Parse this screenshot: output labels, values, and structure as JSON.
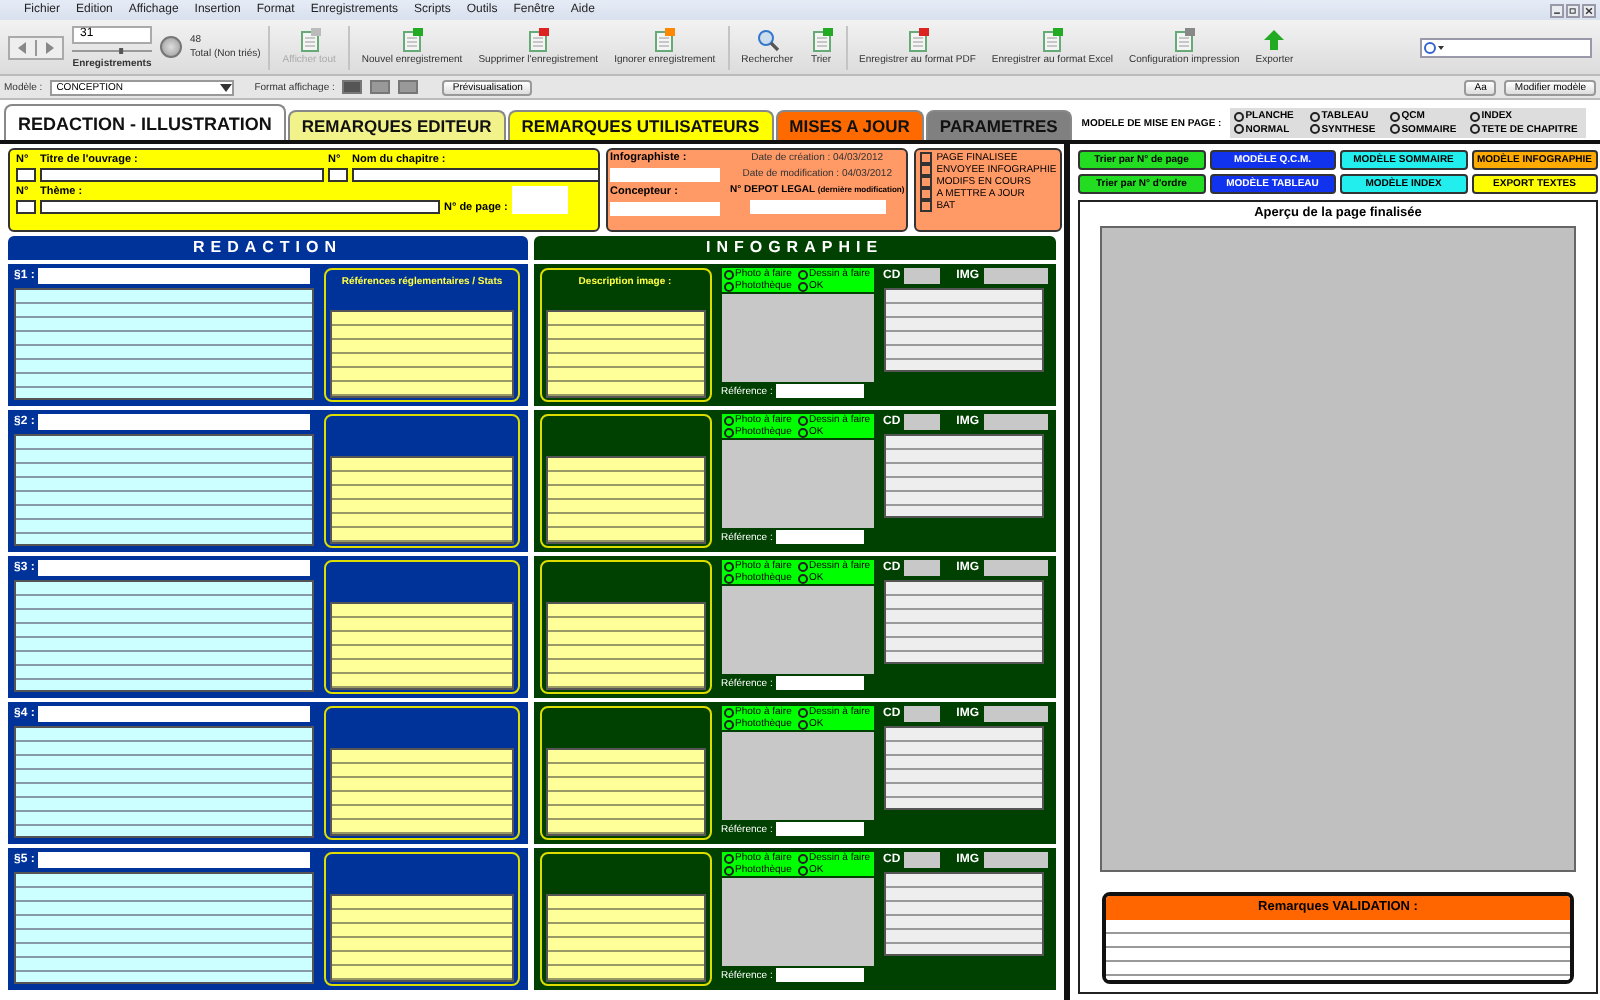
{
  "menu": [
    "Fichier",
    "Edition",
    "Affichage",
    "Insertion",
    "Format",
    "Enregistrements",
    "Scripts",
    "Outils",
    "Fenêtre",
    "Aide"
  ],
  "records": {
    "current": "31",
    "total": "48",
    "total_label": "Total (Non triés)",
    "label": "Enregistrements",
    "level": 0.62
  },
  "toolbar": [
    {
      "label": "Afficher tout",
      "kind": "show",
      "disabled": true
    },
    {
      "label": "Nouvel enregistrement",
      "kind": "new",
      "disabled": false
    },
    {
      "label": "Supprimer l'enregistrement",
      "kind": "delete",
      "disabled": false
    },
    {
      "label": "Ignorer enregistrement",
      "kind": "ignore",
      "disabled": false
    },
    {
      "label": "Rechercher",
      "kind": "search",
      "disabled": false
    },
    {
      "label": "Trier",
      "kind": "sort",
      "disabled": false
    },
    {
      "label": "Enregistrer au format PDF",
      "kind": "pdf",
      "disabled": false
    },
    {
      "label": "Enregistrer au format Excel",
      "kind": "excel",
      "disabled": false
    },
    {
      "label": "Configuration impression",
      "kind": "print",
      "disabled": false
    },
    {
      "label": "Exporter",
      "kind": "export",
      "disabled": false
    }
  ],
  "layout_bar": {
    "model_label": "Modèle :",
    "model": "CONCEPTION",
    "format_label": "Format affichage :",
    "preview": "Prévisualisation",
    "aa": "Aa",
    "edit_model": "Modifier modèle"
  },
  "tabs": [
    {
      "label": "REDACTION - ILLUSTRATION",
      "color": "#ffffff",
      "selected": true
    },
    {
      "label": "REMARQUES EDITEUR",
      "color": "#f2f28a",
      "selected": false
    },
    {
      "label": "REMARQUES UTILISATEURS",
      "color": "#ffff00",
      "selected": false
    },
    {
      "label": "MISES A JOUR",
      "color": "#ff6a00",
      "selected": false
    },
    {
      "label": "PARAMETRES",
      "color": "#808080",
      "selected": false
    }
  ],
  "page_model": {
    "label": "MODELE DE MISE EN PAGE :",
    "options": [
      {
        "label": "PLANCHE",
        "selected": false
      },
      {
        "label": "NORMAL",
        "selected": false
      },
      {
        "label": "TABLEAU",
        "selected": false
      },
      {
        "label": "SYNTHESE",
        "selected": false
      },
      {
        "label": "QCM",
        "selected": false
      },
      {
        "label": "SOMMAIRE",
        "selected": false
      },
      {
        "label": "INDEX",
        "selected": false
      },
      {
        "label": "TETE DE CHAPITRE",
        "selected": false
      }
    ]
  },
  "header": {
    "no1": "N°",
    "title_label": "Titre de l'ouvrage :",
    "no2": "N°",
    "chapter_label": "Nom du chapitre :",
    "no3": "N°",
    "theme_label": "Thème :",
    "page_label": "N° de page :",
    "infographiste": "Infographiste :",
    "concepteur": "Concepteur :",
    "created": "Date de création : 04/03/2012",
    "modified": "Date de modification : 04/03/2012",
    "depot": "N° DEPOT LEGAL",
    "depot_note": "(dernière modification)"
  },
  "status": [
    {
      "label": "PAGE FINALISEE",
      "checked": false
    },
    {
      "label": "ENVOYEE INFOGRAPHIE",
      "checked": false
    },
    {
      "label": "MODIFS EN COURS",
      "checked": false
    },
    {
      "label": "A METTRE A JOUR",
      "checked": false
    },
    {
      "label": "BAT",
      "checked": false
    }
  ],
  "redaction_title": "REDACTION",
  "infographie_title": "INFOGRAPHIE",
  "refs_heading": "Références réglementaires / Stats",
  "desc_heading": "Description image :",
  "paragraphs": [
    {
      "label": "§1 :",
      "options": [
        {
          "label": "Photo à faire",
          "selected": false
        },
        {
          "label": "Dessin à faire",
          "selected": false
        },
        {
          "label": "Photothèque",
          "selected": false
        },
        {
          "label": "OK",
          "selected": false
        }
      ],
      "cd": "CD",
      "img": "IMG",
      "reference": "Référence :"
    },
    {
      "label": "§2 :",
      "options": [
        {
          "label": "Photo à faire",
          "selected": false
        },
        {
          "label": "Dessin à faire",
          "selected": false
        },
        {
          "label": "Photothèque",
          "selected": false
        },
        {
          "label": "OK",
          "selected": false
        }
      ],
      "cd": "CD",
      "img": "IMG",
      "reference": "Référence :"
    },
    {
      "label": "§3 :",
      "options": [
        {
          "label": "Photo à faire",
          "selected": false
        },
        {
          "label": "Dessin à faire",
          "selected": false
        },
        {
          "label": "Photothèque",
          "selected": false
        },
        {
          "label": "OK",
          "selected": false
        }
      ],
      "cd": "CD",
      "img": "IMG",
      "reference": "Référence :"
    },
    {
      "label": "§4 :",
      "options": [
        {
          "label": "Photo à faire",
          "selected": false
        },
        {
          "label": "Dessin à faire",
          "selected": false
        },
        {
          "label": "Photothèque",
          "selected": false
        },
        {
          "label": "OK",
          "selected": false
        }
      ],
      "cd": "CD",
      "img": "IMG",
      "reference": "Référence :"
    },
    {
      "label": "§5 :",
      "options": [
        {
          "label": "Photo à faire",
          "selected": false
        },
        {
          "label": "Dessin à faire",
          "selected": false
        },
        {
          "label": "Photothèque",
          "selected": false
        },
        {
          "label": "OK",
          "selected": false
        }
      ],
      "cd": "CD",
      "img": "IMG",
      "reference": "Référence :"
    }
  ],
  "action_buttons": [
    {
      "label": "Trier par N° de page",
      "color": "#22dd22"
    },
    {
      "label": "MODÈLE Q.C.M.",
      "color": "#1133ee"
    },
    {
      "label": "MODÈLE SOMMAIRE",
      "color": "#22eeee"
    },
    {
      "label": "MODÈLE INFOGRAPHIE",
      "color": "#ffaa00"
    },
    {
      "label": "Trier par N° d'ordre",
      "color": "#22dd22"
    },
    {
      "label": "MODÈLE TABLEAU",
      "color": "#1133ee"
    },
    {
      "label": "MODÈLE INDEX",
      "color": "#22eeee"
    },
    {
      "label": "EXPORT TEXTES",
      "color": "#ffff00"
    }
  ],
  "preview_title": "Aperçu de la page finalisée",
  "validation_title": "Remarques VALIDATION :"
}
